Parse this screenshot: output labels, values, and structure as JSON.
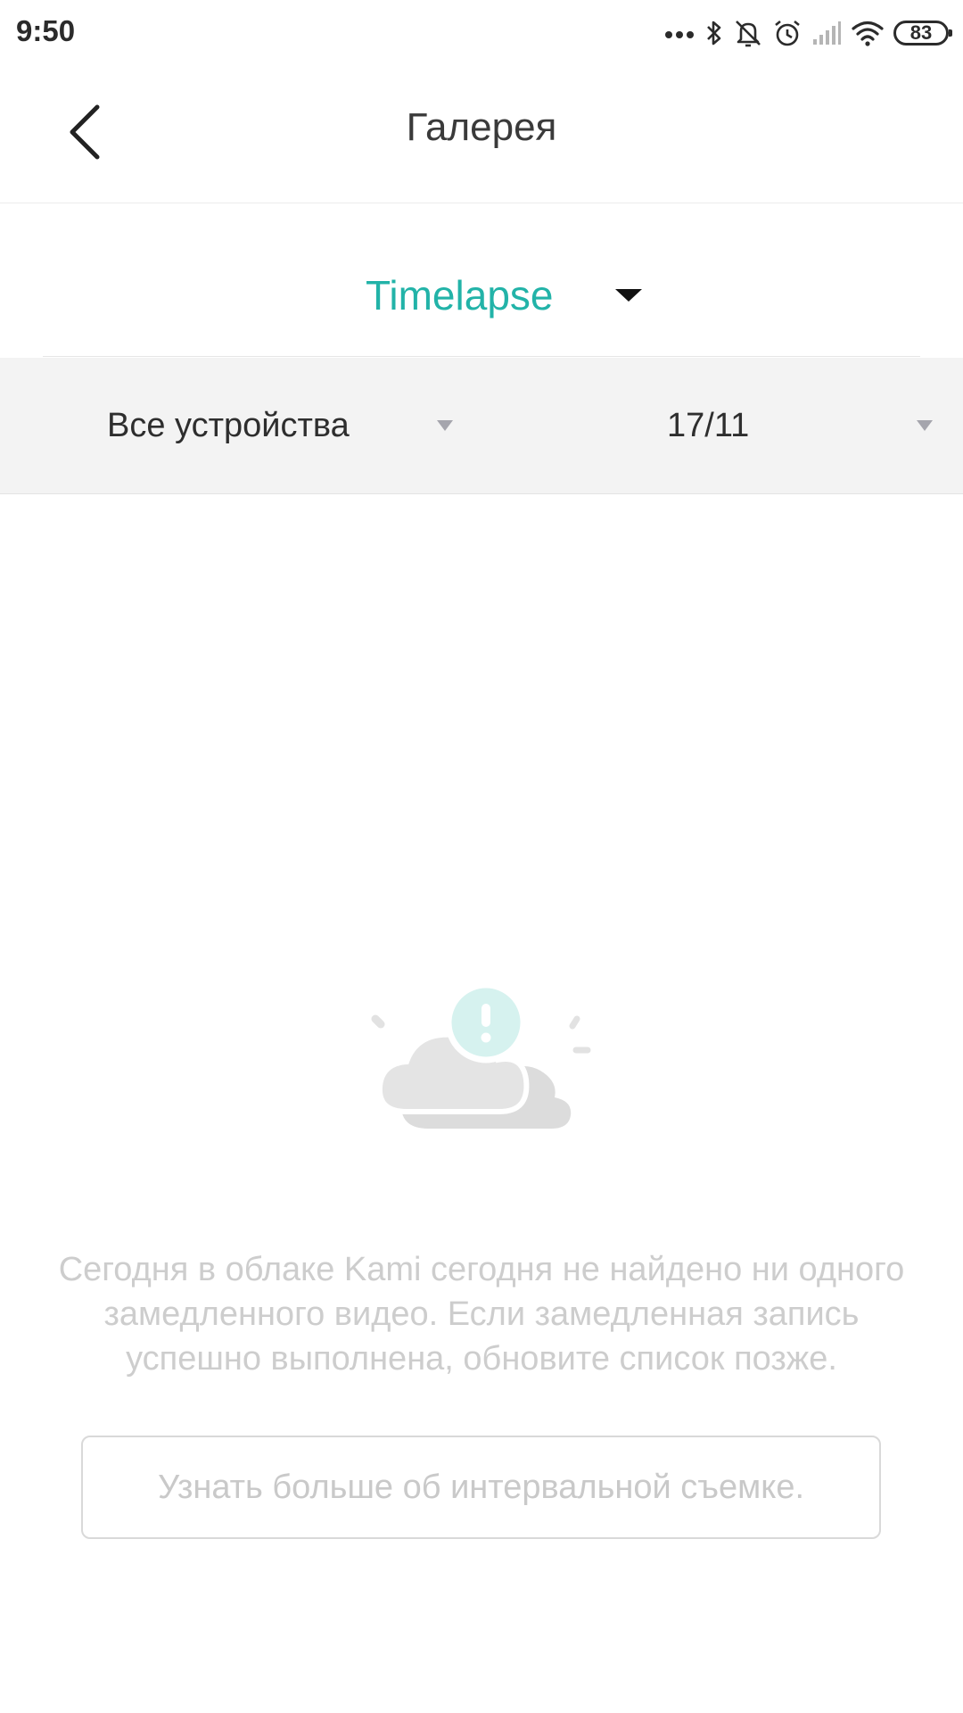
{
  "status_bar": {
    "time": "9:50",
    "battery": "83",
    "icons": [
      "more-dots-icon",
      "bluetooth-icon",
      "mute-icon",
      "alarm-icon",
      "signal-icon",
      "wifi-icon",
      "battery-icon"
    ]
  },
  "header": {
    "title": "Галерея",
    "back_icon": "chevron-left-icon"
  },
  "mode_selector": {
    "selected": "Timelapse",
    "accent_color": "#22b3a8"
  },
  "filters": {
    "devices": "Все устройства",
    "date": "17/11"
  },
  "empty_state": {
    "illustration": "cloud-alert-icon",
    "lines": [
      "Сегодня в облаке Kami сегодня не найдено ни одного",
      "замедленного видео. Если замедленная запись",
      "успешно выполнена, обновите список позже."
    ],
    "button_label": "Узнать больше об интервальной съемке."
  }
}
